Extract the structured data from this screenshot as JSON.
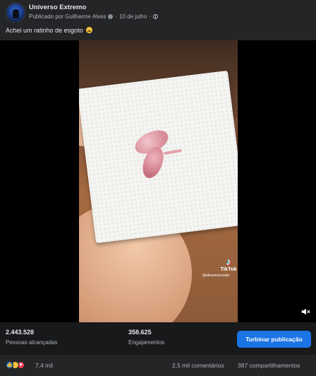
{
  "post": {
    "page_name": "Universo Extremo",
    "published_by": "Publicado por Guilherme Alves",
    "date": "10 de julho",
    "separator": "·",
    "text": "Achei um ratinho de esgoto",
    "text_emoji": "slightly-smiling-face-icon"
  },
  "video": {
    "watermark_brand": "TikTok",
    "watermark_user": "@alissonsouzabr",
    "mute_icon": "speaker-muted-icon"
  },
  "insights": {
    "reach_value": "2.443.528",
    "reach_label": "Pessoas alcançadas",
    "engagement_value": "358.625",
    "engagement_label": "Engajamentos",
    "boost_label": "Turbinar publicação",
    "boost_color": "#1b74e4"
  },
  "footer": {
    "reactions": [
      "like-icon",
      "haha-icon",
      "love-icon"
    ],
    "reaction_count": "7,4 mil",
    "comments": "2,5 mil comentários",
    "shares": "387 compartilhamentos"
  }
}
